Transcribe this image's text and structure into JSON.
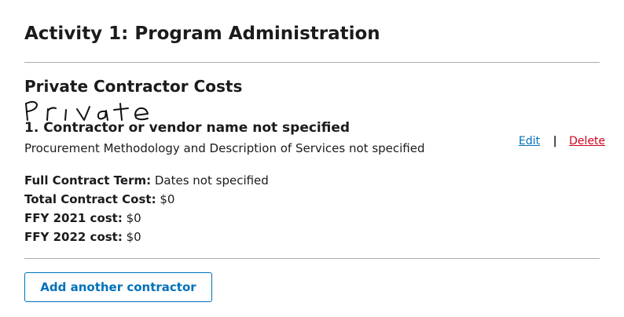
{
  "activity": {
    "title": "Activity 1: Program Administration"
  },
  "section": {
    "title": "Private Contractor Costs",
    "handwritten_annotation": "Private"
  },
  "contractor": {
    "name": "1. Contractor or vendor name not specified",
    "description": "Procurement Methodology and Description of Services not specified",
    "actions": {
      "edit_label": "Edit",
      "separator": "|",
      "delete_label": "Delete"
    },
    "details": [
      {
        "label": "Full Contract Term:",
        "value": " Dates not specified"
      },
      {
        "label": "Total Contract Cost:",
        "value": " $0"
      },
      {
        "label": "FFY 2021 cost:",
        "value": " $0"
      },
      {
        "label": "FFY 2022 cost:",
        "value": " $0"
      }
    ]
  },
  "add_button": {
    "label": "Add another contractor"
  },
  "colors": {
    "link": "#0071bb",
    "delete": "#d0021b",
    "divider": "#a9aeb1",
    "text": "#1b1b1b"
  }
}
